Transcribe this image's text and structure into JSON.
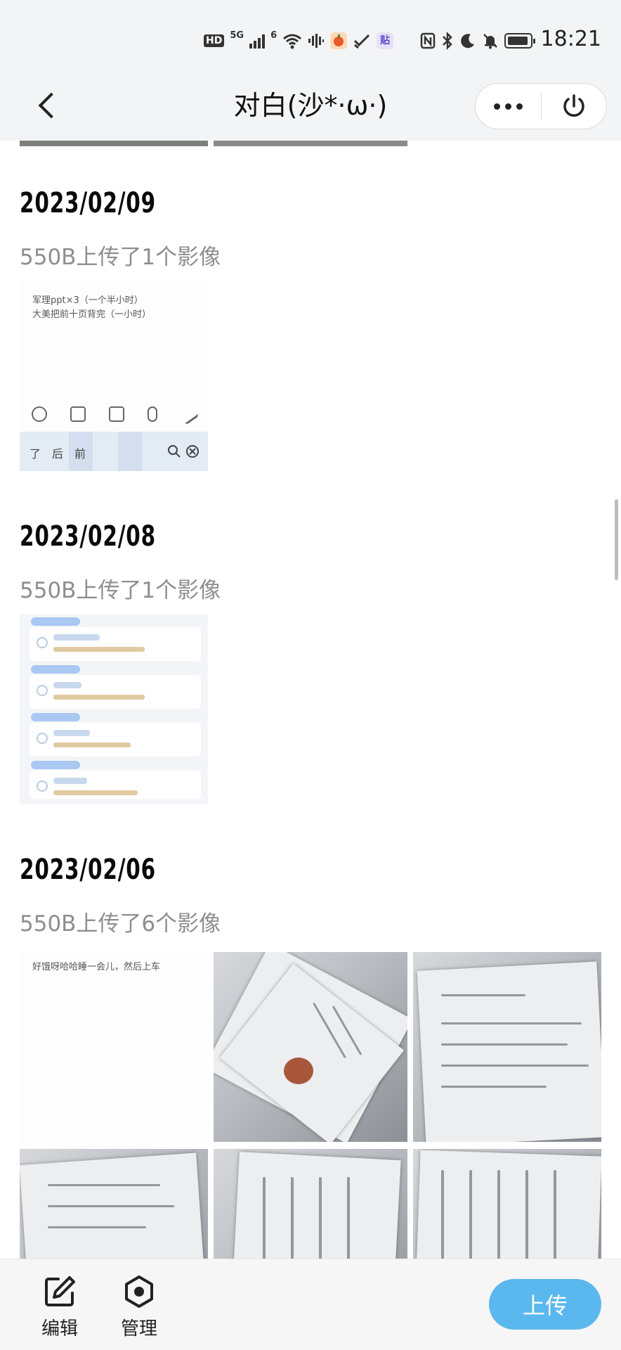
{
  "status_bar": {
    "hd_badge": "HD",
    "network": "5G",
    "network_small": "6",
    "time": "18:21",
    "app_badge_text": "贴"
  },
  "nav": {
    "title": "对白(沙*·ω·)"
  },
  "feed": [
    {
      "date": "2023/02/09",
      "summary": "550B上传了1个影像",
      "note_lines": [
        "军理ppt×3（一个半小时）",
        "大美把前十页背完（一小时）"
      ],
      "keyboard_keys": [
        "了",
        "后",
        "前"
      ]
    },
    {
      "date": "2023/02/08",
      "summary": "550B上传了1个影像"
    },
    {
      "date": "2023/02/06",
      "summary": "550B上传了6个影像",
      "note_text": "好饿呀哈哈睡一会儿，然后上车"
    }
  ],
  "bottom_bar": {
    "edit_label": "编辑",
    "manage_label": "管理",
    "upload_label": "上传"
  },
  "colors": {
    "accent": "#5bb8ee",
    "muted_text": "#8e8e8e",
    "header_bg": "#f3f4f6"
  }
}
